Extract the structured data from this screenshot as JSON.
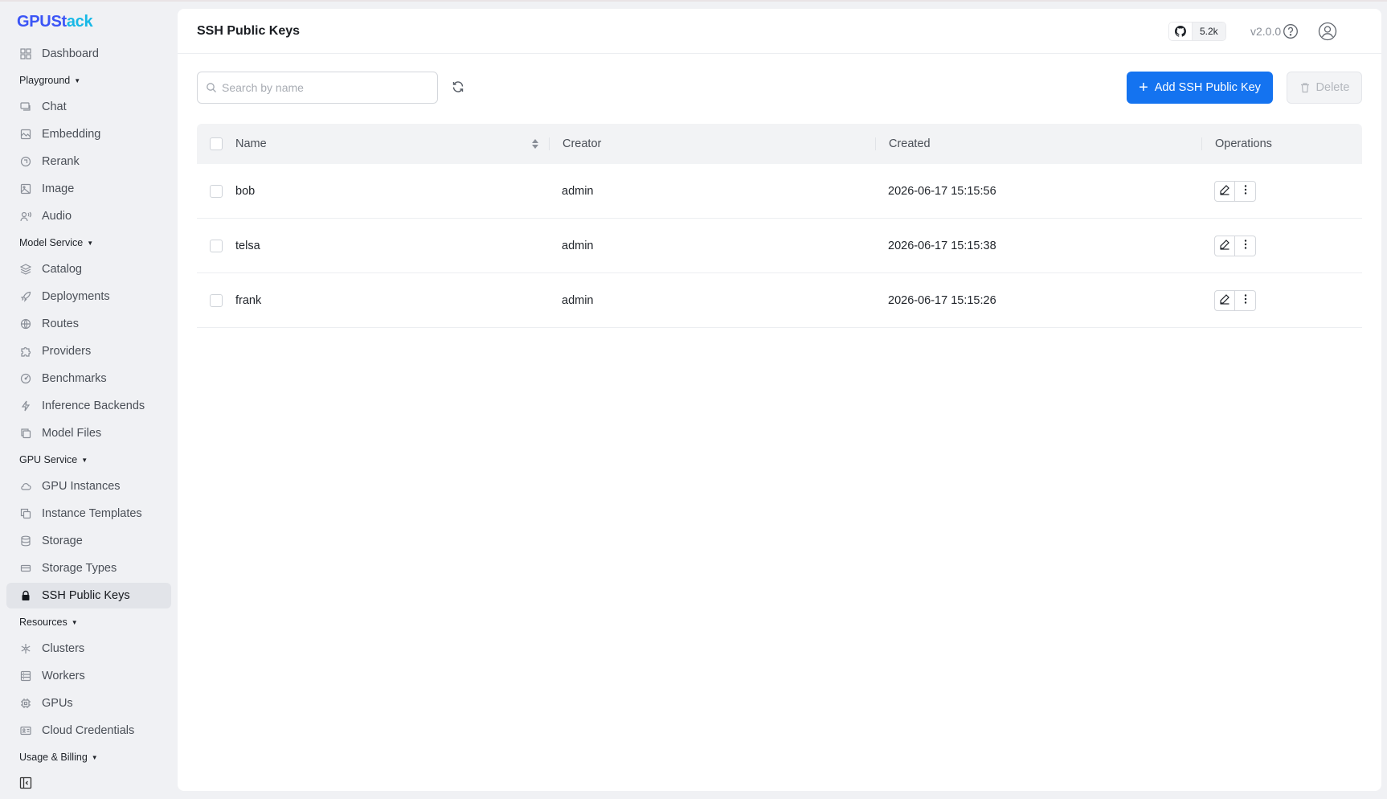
{
  "app": {
    "logo_prefix": "GPUSt",
    "logo_suffix": "ack"
  },
  "sidebar": {
    "dashboard": "Dashboard",
    "groups": [
      {
        "label": "Playground",
        "items": [
          {
            "label": "Chat",
            "icon": "chat-icon"
          },
          {
            "label": "Embedding",
            "icon": "embedding-icon"
          },
          {
            "label": "Rerank",
            "icon": "rerank-icon"
          },
          {
            "label": "Image",
            "icon": "image-icon"
          },
          {
            "label": "Audio",
            "icon": "audio-icon"
          }
        ]
      },
      {
        "label": "Model Service",
        "items": [
          {
            "label": "Catalog",
            "icon": "layers-icon"
          },
          {
            "label": "Deployments",
            "icon": "rocket-icon"
          },
          {
            "label": "Routes",
            "icon": "globe-icon"
          },
          {
            "label": "Providers",
            "icon": "puzzle-icon"
          },
          {
            "label": "Benchmarks",
            "icon": "gauge-icon"
          },
          {
            "label": "Inference Backends",
            "icon": "bolt-icon"
          },
          {
            "label": "Model Files",
            "icon": "files-icon"
          }
        ]
      },
      {
        "label": "GPU Service",
        "items": [
          {
            "label": "GPU Instances",
            "icon": "cloud-icon"
          },
          {
            "label": "Instance Templates",
            "icon": "copy-icon"
          },
          {
            "label": "Storage",
            "icon": "database-icon"
          },
          {
            "label": "Storage Types",
            "icon": "drive-icon"
          },
          {
            "label": "SSH Public Keys",
            "icon": "lock-icon",
            "active": true
          }
        ]
      },
      {
        "label": "Resources",
        "items": [
          {
            "label": "Clusters",
            "icon": "cluster-icon"
          },
          {
            "label": "Workers",
            "icon": "server-icon"
          },
          {
            "label": "GPUs",
            "icon": "chip-icon"
          },
          {
            "label": "Cloud Credentials",
            "icon": "id-card-icon"
          }
        ]
      },
      {
        "label": "Usage & Billing",
        "items": []
      }
    ]
  },
  "header": {
    "title": "SSH Public Keys",
    "github_stars": "5.2k",
    "version": "v2.0.0"
  },
  "toolbar": {
    "search_placeholder": "Search by name",
    "search_value": "",
    "add_label": "Add SSH Public Key",
    "delete_label": "Delete"
  },
  "table": {
    "columns": [
      "Name",
      "Creator",
      "Created",
      "Operations"
    ],
    "rows": [
      {
        "name": "bob",
        "creator": "admin",
        "created": "2026-06-17 15:15:56"
      },
      {
        "name": "telsa",
        "creator": "admin",
        "created": "2026-06-17 15:15:38"
      },
      {
        "name": "frank",
        "creator": "admin",
        "created": "2026-06-17 15:15:26"
      }
    ]
  },
  "colors": {
    "primary": "#1473f0",
    "active_nav_bg": "#e2e4e9",
    "page_bg": "#f0f1f4"
  }
}
